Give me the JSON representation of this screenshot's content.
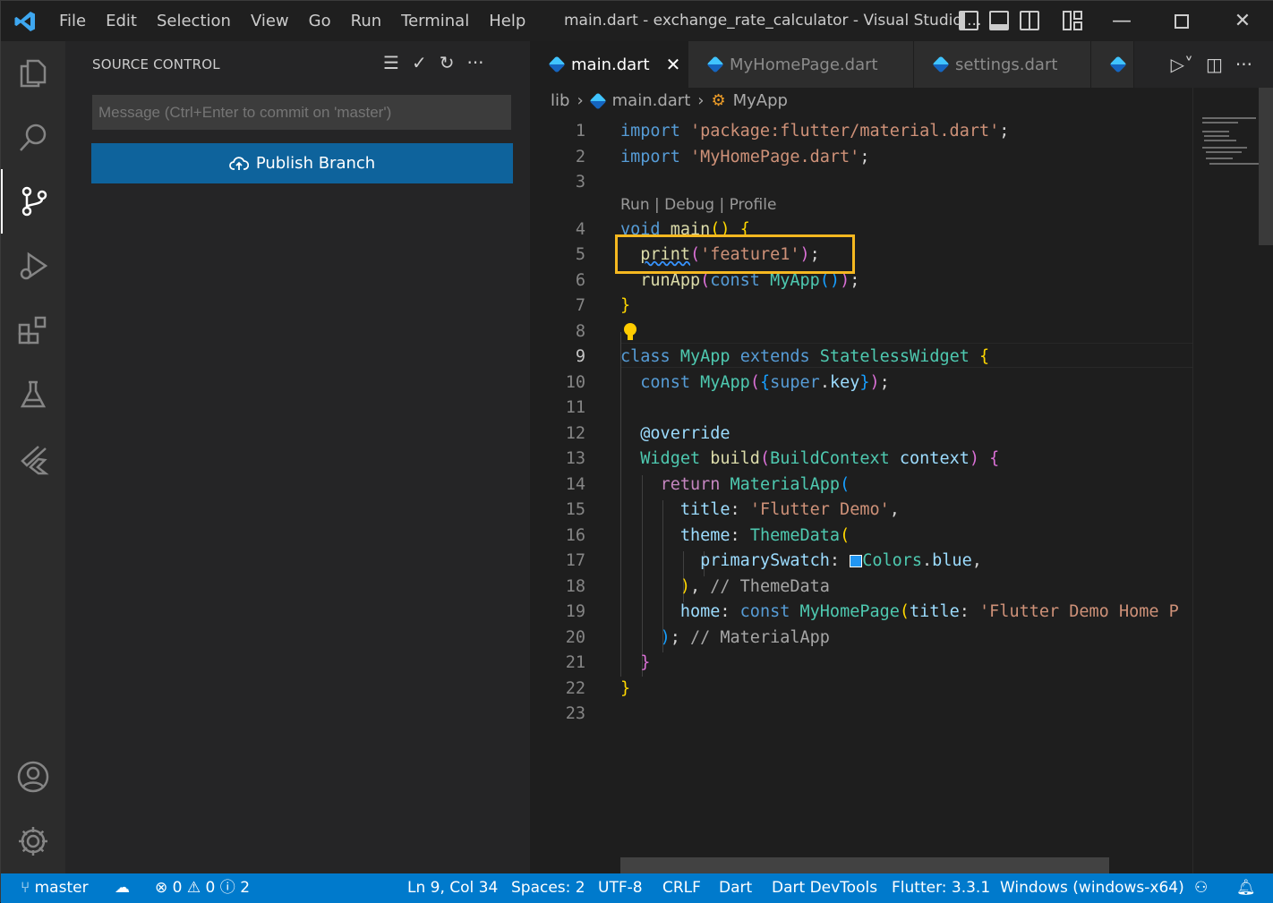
{
  "menu": [
    "File",
    "Edit",
    "Selection",
    "View",
    "Go",
    "Run",
    "Terminal",
    "Help"
  ],
  "window_title": "main.dart - exchange_rate_calculator - Visual Studio ...",
  "sidebar": {
    "title": "SOURCE CONTROL",
    "message_placeholder": "Message (Ctrl+Enter to commit on 'master')",
    "publish_label": "Publish Branch"
  },
  "tabs": [
    {
      "label": "main.dart",
      "active": true
    },
    {
      "label": "MyHomePage.dart",
      "active": false
    },
    {
      "label": "settings.dart",
      "active": false
    }
  ],
  "breadcrumb": {
    "folder": "lib",
    "file": "main.dart",
    "symbol": "MyApp"
  },
  "codelens": "Run | Debug | Profile",
  "line_numbers": [
    "1",
    "2",
    "3",
    "4",
    "5",
    "6",
    "7",
    "8",
    "9",
    "10",
    "11",
    "12",
    "13",
    "14",
    "15",
    "16",
    "17",
    "18",
    "19",
    "20",
    "21",
    "22",
    "23"
  ],
  "code": {
    "l1_kw": "import",
    "l1_str": "'package:flutter/material.dart'",
    "l2_kw": "import",
    "l2_str": "'MyHomePage.dart'",
    "l4_kw": "void",
    "l4_fn": "main",
    "l5_fn": "print",
    "l5_str": "'feature1'",
    "l6_fn": "runApp",
    "l6_kw": "const",
    "l6_type": "MyApp",
    "l9_kw1": "class",
    "l9_type1": "MyApp",
    "l9_kw2": "extends",
    "l9_type2": "StatelessWidget",
    "l10_kw": "const",
    "l10_type": "MyApp",
    "l10_kw2": "super",
    "l10_prop": "key",
    "l12_ann": "@override",
    "l13_type1": "Widget",
    "l13_fn": "build",
    "l13_type2": "BuildContext",
    "l13_param": "context",
    "l14_kw": "return",
    "l14_type": "MaterialApp",
    "l15_prop": "title",
    "l15_str": "'Flutter Demo'",
    "l16_prop": "theme",
    "l16_type": "ThemeData",
    "l17_prop": "primarySwatch",
    "l17_type": "Colors",
    "l17_prop2": "blue",
    "l18_comment": "// ThemeData",
    "l19_prop": "home",
    "l19_kw": "const",
    "l19_type": "MyHomePage",
    "l19_prop2": "title",
    "l19_str": "'Flutter Demo Home P",
    "l20_comment": "// MaterialApp"
  },
  "status": {
    "branch": "master",
    "errors": "0",
    "warnings": "0",
    "infos": "2",
    "cursor": "Ln 9, Col 34",
    "spaces": "Spaces: 2",
    "encoding": "UTF-8",
    "eol": "CRLF",
    "language": "Dart",
    "devtools": "Dart DevTools",
    "flutter": "Flutter: 3.3.1",
    "device": "Windows (windows-x64)"
  },
  "colors": {
    "accent": "#007acc",
    "button": "#0e639c",
    "highlight_box": "#f5b820"
  }
}
